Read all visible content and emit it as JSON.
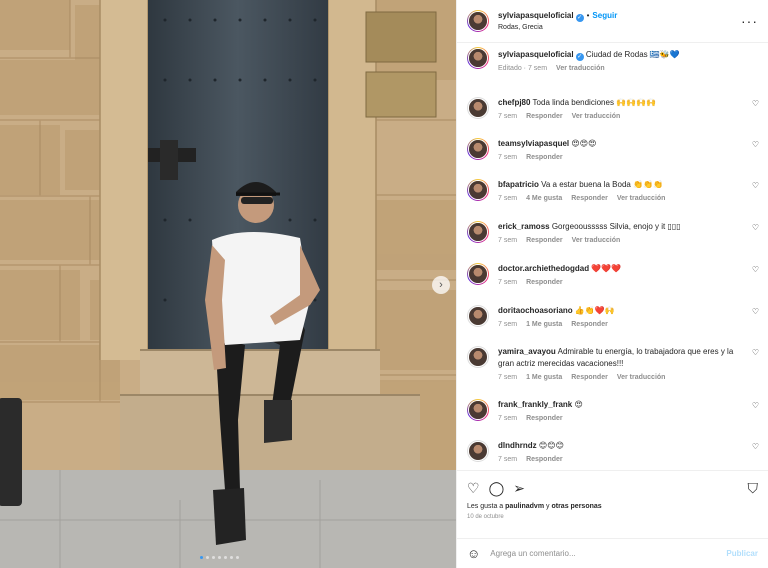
{
  "post": {
    "username": "sylviapasqueloficial",
    "follow_label": "Seguir",
    "separator": "•",
    "location": "Rodas, Grecia"
  },
  "caption": {
    "username": "sylviapasqueloficial",
    "text": "Ciudad de Rodas 🇬🇷🐝💙",
    "meta": [
      "Editado · 7 sem",
      "Ver traducción"
    ]
  },
  "comments": [
    {
      "username": "chefpj80",
      "text": "Toda linda bendiciones 🙌🙌🙌🙌",
      "meta": [
        "7 sem",
        "Responder",
        "Ver traducción"
      ]
    },
    {
      "username": "teamsylviapasquel",
      "text": "😍😍😍",
      "meta": [
        "7 sem",
        "Responder"
      ]
    },
    {
      "username": "bfapatricio",
      "text": "Va a estar buena la Boda 👏👏👏",
      "meta": [
        "7 sem",
        "4 Me gusta",
        "Responder",
        "Ver traducción"
      ]
    },
    {
      "username": "erick_ramoss",
      "text": "Gorgeoousssss Silvia, enojo y it ▯▯▯",
      "meta": [
        "7 sem",
        "Responder",
        "Ver traducción"
      ]
    },
    {
      "username": "doctor.archiethedogdad",
      "text": "❤️❤️❤️",
      "meta": [
        "7 sem",
        "Responder"
      ]
    },
    {
      "username": "doritaochoasoriano",
      "text": "👍👏❤️🙌",
      "meta": [
        "7 sem",
        "1 Me gusta",
        "Responder"
      ]
    },
    {
      "username": "yamira_avayou",
      "text": "Admirable tu energía, lo trabajadora que eres y la gran actriz merecidas vacaciones!!!",
      "meta": [
        "7 sem",
        "1 Me gusta",
        "Responder",
        "Ver traducción"
      ]
    },
    {
      "username": "frank_frankly_frank",
      "text": "😍",
      "meta": [
        "7 sem",
        "Responder"
      ]
    },
    {
      "username": "dlndhrndz",
      "text": "😊😊😊",
      "meta": [
        "7 sem",
        "Responder"
      ]
    }
  ],
  "likes": {
    "prefix": "Les gusta a",
    "user": "paulinadvm",
    "joiner": "y",
    "others": "otras personas"
  },
  "date": "10 de octubre",
  "comment_box": {
    "placeholder": "Agrega un comentario...",
    "publish": "Publicar"
  },
  "icons": {
    "like": "heart-icon",
    "comment": "comment-icon",
    "share": "share-icon",
    "save": "bookmark-icon",
    "more": "more-icon",
    "emoji": "emoji-icon"
  }
}
